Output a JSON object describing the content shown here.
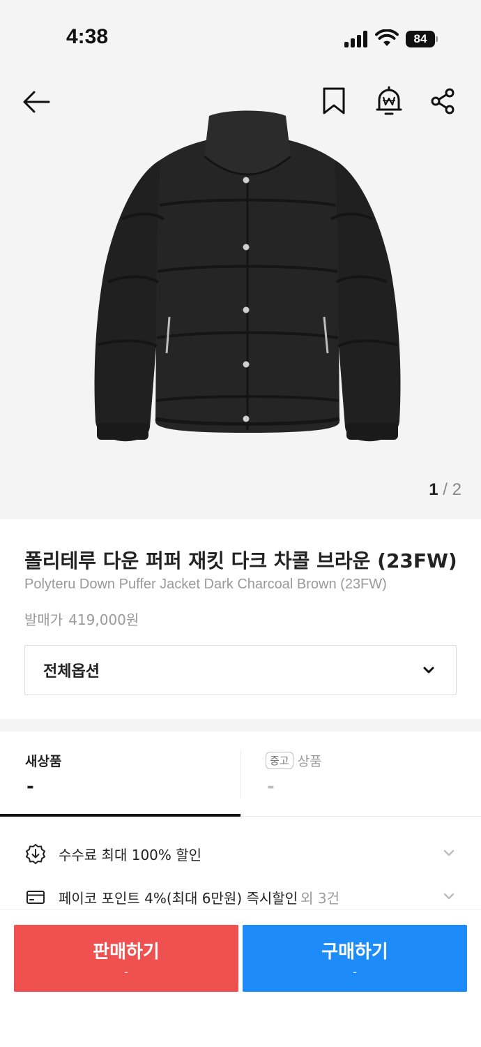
{
  "status_bar": {
    "time": "4:38",
    "battery": "84",
    "icons": [
      "signal-icon",
      "wifi-icon",
      "battery-icon"
    ]
  },
  "header": {
    "icons": [
      "back-arrow-icon",
      "bookmark-icon",
      "price-alarm-icon",
      "share-icon"
    ]
  },
  "gallery": {
    "current": "1",
    "separator": " / ",
    "total": "2"
  },
  "product": {
    "name_ko": "폴리테루 다운 퍼퍼 재킷 다크 차콜 브라운 (23FW)",
    "name_en": "Polyteru Down Puffer Jacket Dark Charcoal Brown (23FW)",
    "release_label": "발매가",
    "release_price": "419,000원"
  },
  "option_select": {
    "label": "전체옵션"
  },
  "tabs": {
    "new": {
      "title": "새상품",
      "value": "-"
    },
    "used": {
      "badge": "중고",
      "title": "상품",
      "value": "-"
    }
  },
  "benefits": [
    {
      "text": "수수료 최대 100% 할인",
      "extra": "",
      "icon": "discount-badge-icon"
    },
    {
      "text": "페이코 포인트 4%(최대 6만원) 즉시할인",
      "extra": "외 3건",
      "icon": "card-icon"
    }
  ],
  "actions": {
    "sell": {
      "label": "판매하기",
      "price": "-"
    },
    "buy": {
      "label": "구매하기",
      "price": "-"
    }
  },
  "colors": {
    "sell": "#ef5050",
    "buy": "#1d8cf8",
    "background_gray": "#f4f4f4"
  }
}
